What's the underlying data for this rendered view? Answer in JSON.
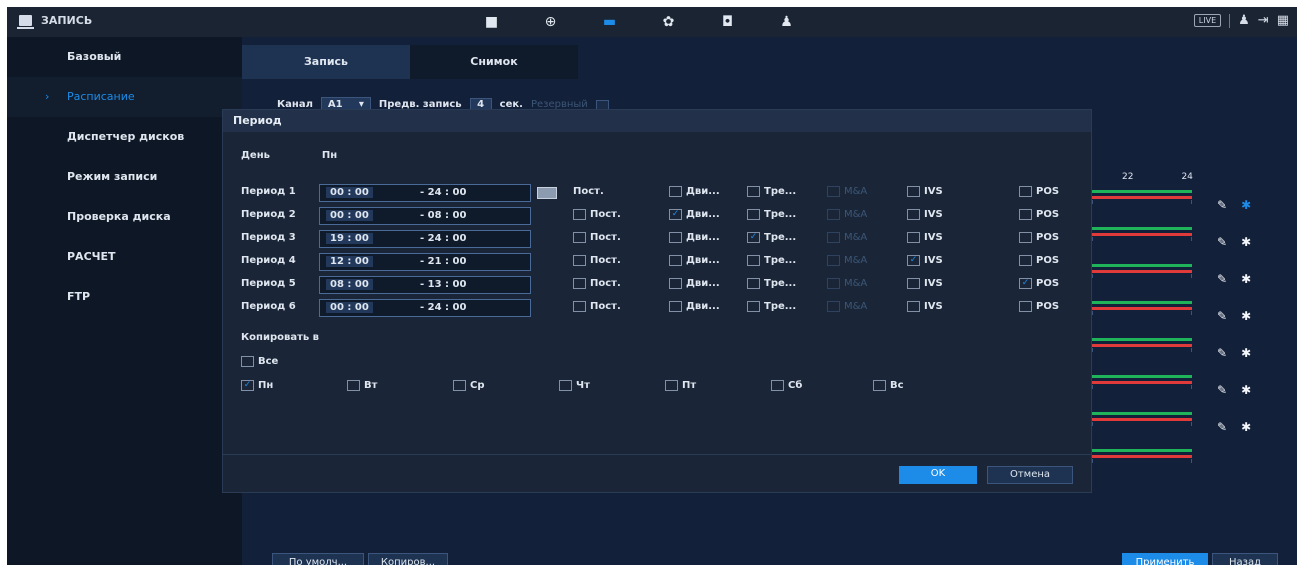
{
  "app": {
    "title": "ЗАПИСЬ"
  },
  "topbar": {
    "icons": [
      "camera-icon",
      "network-icon",
      "storage-icon",
      "settings-icon",
      "security-icon",
      "account-icon"
    ],
    "live_label": "LIVE"
  },
  "sidebar": {
    "items": [
      {
        "label": "Базовый",
        "active": false
      },
      {
        "label": "Расписание",
        "active": true
      },
      {
        "label": "Диспетчер дисков",
        "active": false
      },
      {
        "label": "Режим записи",
        "active": false
      },
      {
        "label": "Проверка диска",
        "active": false
      },
      {
        "label": "РАСЧЕТ",
        "active": false
      },
      {
        "label": "FTP",
        "active": false
      }
    ]
  },
  "tabs": [
    {
      "label": "Запись",
      "active": true
    },
    {
      "label": "Снимок",
      "active": false
    }
  ],
  "filter": {
    "channel_label": "Канал",
    "channel_value": "A1",
    "prerecord_label": "Предв. запись",
    "prerecord_value": "4",
    "prerecord_unit": "сек.",
    "redundant_label": "Резервный"
  },
  "timeline": {
    "ticks": [
      "22",
      "24"
    ]
  },
  "bottom": {
    "default_label": "По умолч...",
    "copy_label": "Копиров...",
    "apply_label": "Применить",
    "back_label": "Назад"
  },
  "dialog": {
    "title": "Период",
    "day_label": "День",
    "day_value": "Пн",
    "types": [
      "Пост.",
      "Дви...",
      "Тре...",
      "M&A",
      "IVS",
      "POS"
    ],
    "periods": [
      {
        "label": "Период 1",
        "start": "00 : 00",
        "end": "- 24 : 00",
        "checks": [
          false,
          false,
          false,
          false,
          false,
          false
        ]
      },
      {
        "label": "Период 2",
        "start": "00 : 00",
        "end": "- 08 : 00",
        "checks": [
          false,
          true,
          false,
          false,
          false,
          false
        ]
      },
      {
        "label": "Период 3",
        "start": "19 : 00",
        "end": "- 24 : 00",
        "checks": [
          false,
          false,
          true,
          false,
          false,
          false
        ]
      },
      {
        "label": "Период 4",
        "start": "12 : 00",
        "end": "- 21 : 00",
        "checks": [
          false,
          false,
          false,
          false,
          true,
          false
        ]
      },
      {
        "label": "Период 5",
        "start": "08 : 00",
        "end": "- 13 : 00",
        "checks": [
          false,
          false,
          false,
          false,
          false,
          true
        ]
      },
      {
        "label": "Период 6",
        "start": "00 : 00",
        "end": "- 24 : 00",
        "checks": [
          false,
          false,
          false,
          false,
          false,
          false
        ]
      }
    ],
    "copy_to_label": "Копировать в",
    "all_label": "Все",
    "days": [
      {
        "label": "Пн",
        "checked": true
      },
      {
        "label": "Вт",
        "checked": false
      },
      {
        "label": "Ср",
        "checked": false
      },
      {
        "label": "Чт",
        "checked": false
      },
      {
        "label": "Пт",
        "checked": false
      },
      {
        "label": "Сб",
        "checked": false
      },
      {
        "label": "Вс",
        "checked": false
      }
    ],
    "ok_label": "OK",
    "cancel_label": "Отмена"
  },
  "colors": {
    "accent": "#1c8ce8",
    "timeline_green": "#1fb35a",
    "timeline_red": "#e03a3a",
    "background": "#0b1220"
  }
}
